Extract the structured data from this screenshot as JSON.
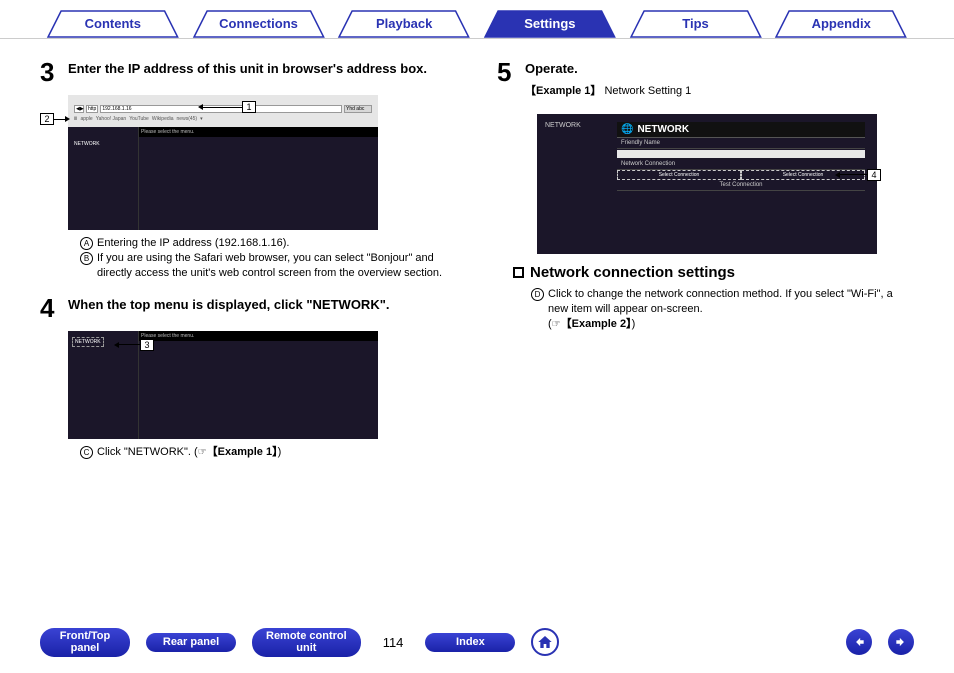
{
  "tabs": {
    "t0": "Contents",
    "t1": "Connections",
    "t2": "Playback",
    "t3": "Settings",
    "t4": "Tips",
    "t5": "Appendix"
  },
  "active_tab_index": 3,
  "left": {
    "step3": {
      "title": "Enter the IP address of this unit in browser's address box.",
      "shot": {
        "addr_label": "http",
        "addr_val": "192.168.1.16",
        "topdot": "Yhd abc",
        "bk0": "apple",
        "bk1": "Yahoo! Japan",
        "bk2": "YouTube",
        "bk3": "Wikipedia",
        "bk4": "news(45)",
        "side_item": "NETWORK",
        "hint": "Please select the menu."
      },
      "notes": {
        "n1": "Entering the IP address (192.168.1.16).",
        "n2": "If you are using the Safari web browser, you can select \"Bonjour\" and directly access the unit's web control screen from the overview section."
      }
    },
    "step4": {
      "title": "When the top menu is displayed, click \"NETWORK\".",
      "shot": {
        "side_item": "NETWORK",
        "hint": "Please select the menu."
      },
      "note": {
        "pre": "Click \"NETWORK\". (",
        "ex": "【Example 1】",
        "post": ")"
      }
    }
  },
  "right": {
    "step5": {
      "title": "Operate.",
      "sub_pre": "【Example 1】",
      "sub_post": " Network Setting 1",
      "shot": {
        "side": "NETWORK",
        "title": "NETWORK",
        "row_fn": "Friendly Name",
        "row_nc": "Network Connection",
        "sel1": "Select Connection",
        "sel2": "Select Connection",
        "row_tc": "Test Connection"
      }
    },
    "subheading": "Network connection settings",
    "note4": {
      "line1": "Click to change the network connection method. If you select \"Wi-Fi\", a new item will appear on-screen.",
      "ex": "【Example 2】",
      "pre": "(",
      "post": ")"
    }
  },
  "callouts": {
    "c1": "1",
    "c2": "2",
    "c3": "3",
    "c4": "4"
  },
  "bottom": {
    "b0a": "Front/Top",
    "b0b": "panel",
    "b1": "Rear panel",
    "b2a": "Remote control",
    "b2b": "unit",
    "page": "114",
    "b3": "Index"
  }
}
